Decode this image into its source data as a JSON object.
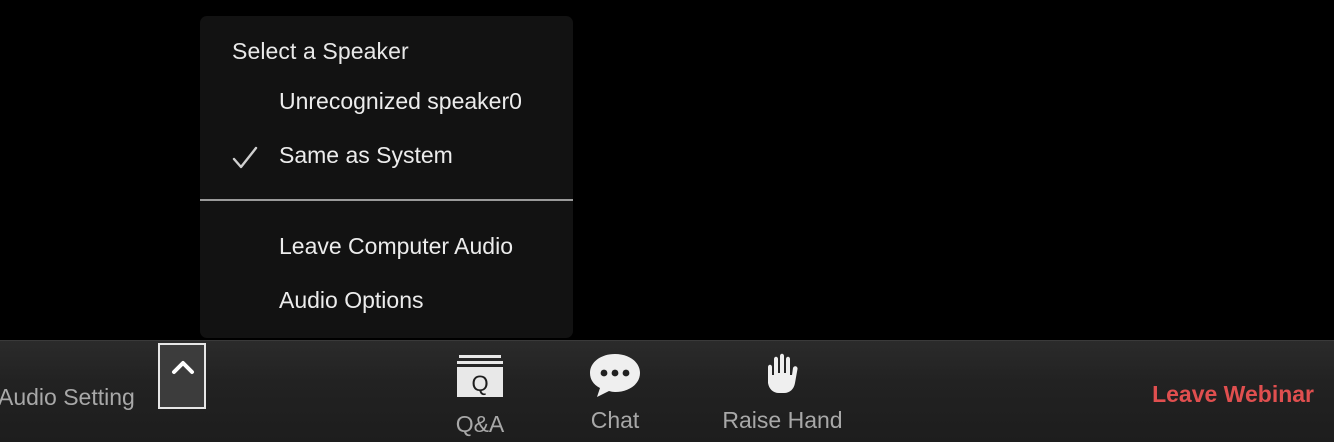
{
  "speaker_menu": {
    "header": "Select a Speaker",
    "items": [
      {
        "label": "Unrecognized speaker0",
        "checked": false
      },
      {
        "label": "Same as System",
        "checked": true
      }
    ],
    "actions": [
      {
        "label": "Leave Computer Audio"
      },
      {
        "label": "Audio Options"
      }
    ]
  },
  "toolbar": {
    "audio_setting_label": "Audio Setting",
    "caret_icon": "chevron-up-icon",
    "tools": [
      {
        "label": "Q&A",
        "icon": "qa-icon",
        "glyph": "Q"
      },
      {
        "label": "Chat",
        "icon": "chat-bubble-icon"
      },
      {
        "label": "Raise Hand",
        "icon": "raise-hand-icon"
      }
    ],
    "leave_label": "Leave Webinar"
  },
  "colors": {
    "background": "#000000",
    "menu_background": "#121212",
    "toolbar_background": "#222222",
    "label_gray": "#a8a8a8",
    "leave_red": "#e04f4f"
  }
}
